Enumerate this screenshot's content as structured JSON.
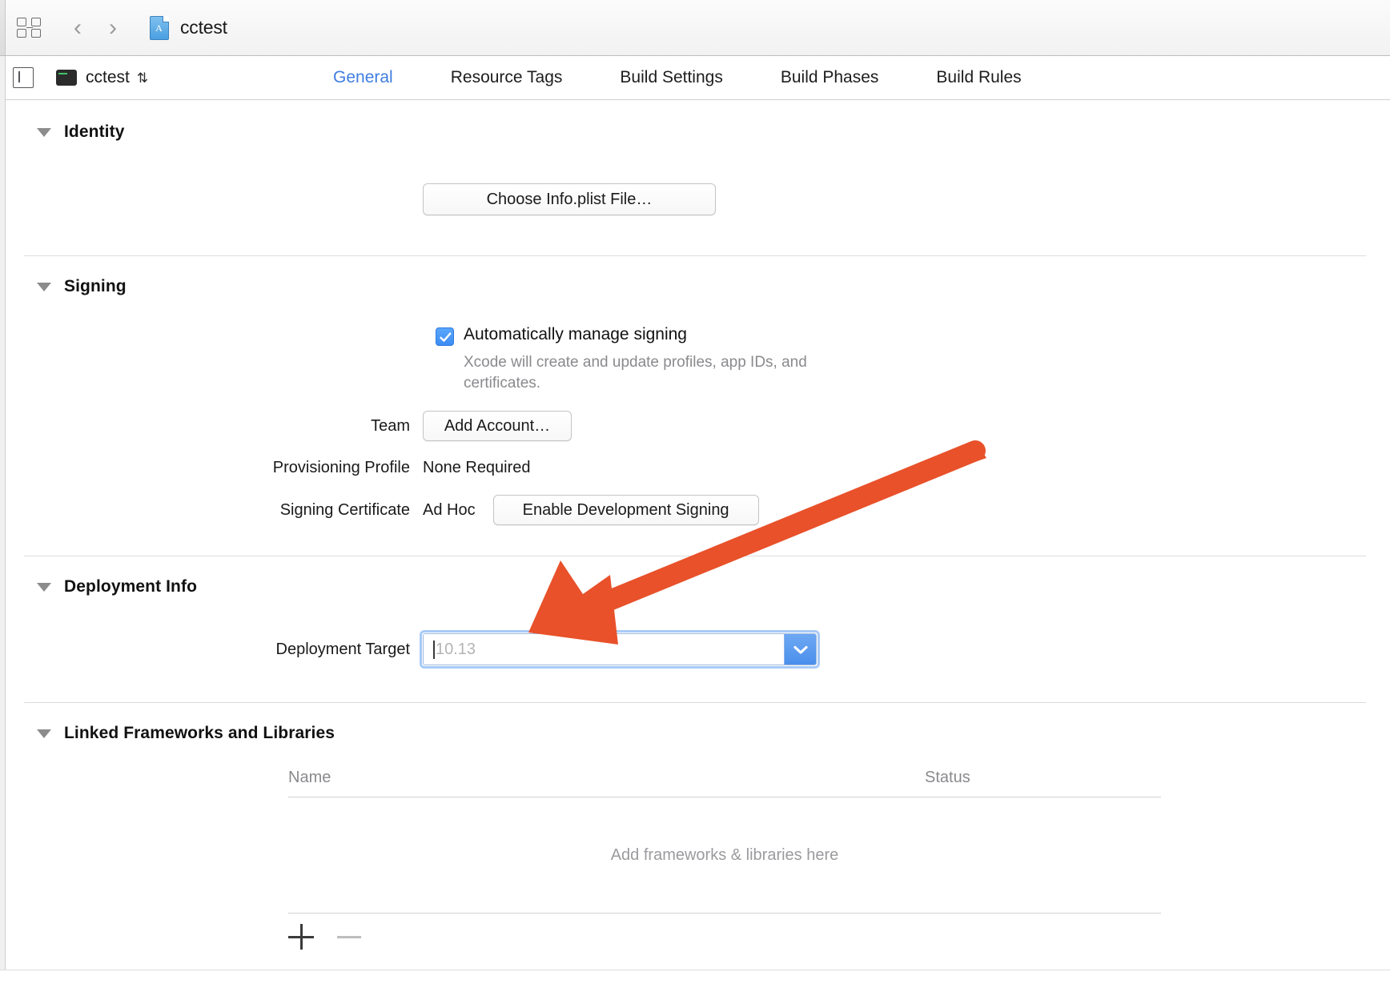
{
  "window": {
    "document_title": "cctest"
  },
  "toolbar": {
    "grid_icon": "project-navigator-icon",
    "back_label": "‹",
    "forward_label": "›",
    "doc_icon": "app-project-file-icon",
    "doc_glyph": "A",
    "title": "cctest"
  },
  "tabbar": {
    "pane_toggle_icon": "toggle-navigator-icon",
    "target_name": "cctest",
    "target_stepper_glyph": "⇅",
    "tabs": [
      {
        "label": "General",
        "active": true
      },
      {
        "label": "Resource Tags",
        "active": false
      },
      {
        "label": "Build Settings",
        "active": false
      },
      {
        "label": "Build Phases",
        "active": false
      },
      {
        "label": "Build Rules",
        "active": false
      }
    ]
  },
  "sections": {
    "identity": {
      "title": "Identity",
      "choose_plist_button": "Choose Info.plist File…"
    },
    "signing": {
      "title": "Signing",
      "auto_manage_label": "Automatically manage signing",
      "auto_manage_checked": true,
      "help_text": "Xcode will create and update profiles, app IDs, and certificates.",
      "team_label": "Team",
      "team_button": "Add Account…",
      "provisioning_profile_label": "Provisioning Profile",
      "provisioning_profile_value": "None Required",
      "signing_certificate_label": "Signing Certificate",
      "signing_certificate_value": "Ad Hoc",
      "enable_dev_signing_button": "Enable Development Signing"
    },
    "deployment_info": {
      "title": "Deployment Info",
      "deployment_target_label": "Deployment Target",
      "deployment_target_value": "",
      "deployment_target_placeholder": "10.13"
    },
    "linked_frameworks": {
      "title": "Linked Frameworks and Libraries",
      "columns": [
        "Name",
        "Status"
      ],
      "rows": [],
      "empty_text": "Add frameworks & libraries here",
      "add_button_label": "+",
      "remove_button_label": "−"
    }
  },
  "annotation": {
    "arrow_color": "#e8512a",
    "points_to": "deployment-target-field"
  },
  "colors": {
    "accent_blue": "#3f7ee0",
    "checkbox_blue": "#3d8cf5",
    "arrow_orange": "#e8512a",
    "placeholder_grey": "#b4b4b4"
  }
}
